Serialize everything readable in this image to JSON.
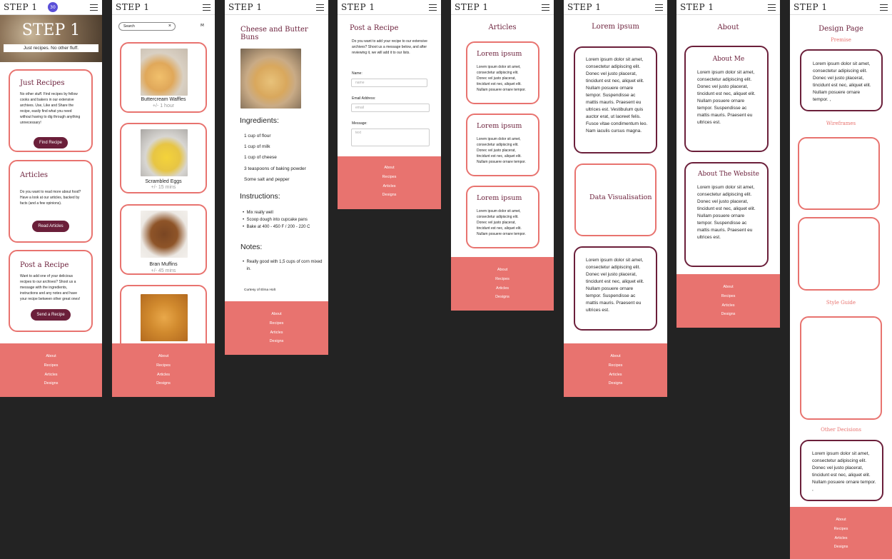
{
  "brand": "STEP 1",
  "badge": "30",
  "footer": [
    "About",
    "Recipes",
    "Articles",
    "Designs"
  ],
  "home": {
    "hero_title": "STEP 1",
    "hero_tagline": "Just recipes. No other fluff.",
    "cards": [
      {
        "title": "Just Recipes",
        "text": "No other stuff. Find recipes by fellow cooks and bakers in our extensive archives. Use, Like and Share the recipe, easily find what you need without having to dig through anything unnecessary!",
        "button": "Find Recipe"
      },
      {
        "title": "Articles",
        "text": "Do you want to read more about food? Have a look at our articles, backed by facts (and a few opinions).",
        "button": "Read Articles"
      },
      {
        "title": "Post a Recipe",
        "text": "Want to add one of your delicious recipes to our archives? Shoot us a message with the ingredients, instructions and any notes and have your recipe between other great ones!",
        "button": "Send a Recipe"
      }
    ]
  },
  "recipes": {
    "search_placeholder": "Search",
    "clear": "×",
    "filter_icon": "utensils-icon",
    "items": [
      {
        "name": "Buttercream Waffles",
        "time": "+/- 1 hour"
      },
      {
        "name": "Scrambled Eggs",
        "time": "+/- 15 mins"
      },
      {
        "name": "Bran Muffins",
        "time": "+/- 45 mins"
      },
      {
        "name": "",
        "time": ""
      }
    ]
  },
  "recipe": {
    "title": "Cheese and Butter Buns",
    "ingredients_heading": "Ingredients:",
    "ingredients": [
      "1 cup of flour",
      "1 cup of milk",
      "1 cup of cheese",
      "3 teaspoons of baking powder",
      "Some salt and pepper"
    ],
    "instructions_heading": "Instructions:",
    "instructions": [
      "Mix really well",
      "Scoop dough into cupcake pans",
      "Bake at 400 - 450 F / 200 - 220 C"
    ],
    "notes_heading": "Notes:",
    "notes": [
      "Really good with 1,5 cups of corn mixed in."
    ],
    "credit": "Curtesy of Elma Holt"
  },
  "post": {
    "title": "Post a Recipe",
    "intro": "Do you want to add your recipe to our extensive archives? Shoot us a message below, and after reviewing it, we will add it to our lists.",
    "name_label": "Name:",
    "name_placeholder": "name",
    "email_label": "Email Address:",
    "email_placeholder": "email",
    "message_label": "Message:",
    "message_placeholder": "text"
  },
  "articles": {
    "title": "Articles",
    "items": [
      {
        "title": "Lorem ipsum",
        "text": "Lorem ipsum dolor sit amet, consectetur adipiscing elit. Donec vel justo placerat, tincidunt est nec, aliquet elit. Nullam posuere ornare tempor."
      },
      {
        "title": "Lorem ipsum",
        "text": "Lorem ipsum dolor sit amet, consectetur adipiscing elit. Donec vel justo placerat, tincidunt est nec, aliquet elit. Nullam posuere ornare tempor."
      },
      {
        "title": "Lorem ipsum",
        "text": "Lorem ipsum dolor sit amet, consectetur adipiscing elit. Donec vel justo placerat, tincidunt est nec, aliquet elit. Nullam posuere ornare tempor."
      }
    ]
  },
  "article": {
    "title": "Lorem ipsum",
    "para1": "Lorem ipsum dolor sit amet, consectetur adipiscing elit. Donec vel justo placerat, tincidunt est nec, aliquet elit. Nullam posuere ornare tempor. Suspendisse ac mattis mauris. Praesent eu ultrices est. Vestibulum quis auctor erat, ut laoreet felis. Fusce vitae condimentum leo. Nam iaculis cursus magna.",
    "viz": "Data Visualisation",
    "para2": "Lorem ipsum dolor sit amet, consectetur adipiscing elit. Donec vel justo placerat, tincidunt est nec, aliquet elit. Nullam posuere ornare tempor. Suspendisse ac mattis mauris. Praesent eu ultrices est."
  },
  "about": {
    "title": "About",
    "me_title": "About Me",
    "me_text": "Lorem ipsum dolor sit amet, consectetur adipiscing elit. Donec vel justo placerat, tincidunt est nec, aliquet elit. Nullam posuere ornare tempor. Suspendisse ac mattis mauris. Praesent eu ultrices est.",
    "site_title": "About The Website",
    "site_text": "Lorem ipsum dolor sit amet, consectetur adipiscing elit. Donec vel justo placerat, tincidunt est nec, aliquet elit. Nullam posuere ornare tempor. Suspendisse ac mattis mauris. Praesent eu ultrices est."
  },
  "design": {
    "title": "Design Page",
    "premise": "Premise",
    "premise_text": "Lorem ipsum dolor sit amet, consectetur adipiscing elit. Donec vel justo placerat, tincidunt est nec, aliquet elit. Nullam posuere ornare tempor. ,",
    "wireframes": "Wireframes",
    "style_guide": "Style Guide",
    "other": "Other Decisions",
    "other_text": "Lorem ipsum dolor sit amet, consectetur adipiscing elit. Donec vel justo placerat, tincidunt est nec, aliquet elit. Nullam posuere ornare tempor. ,"
  }
}
